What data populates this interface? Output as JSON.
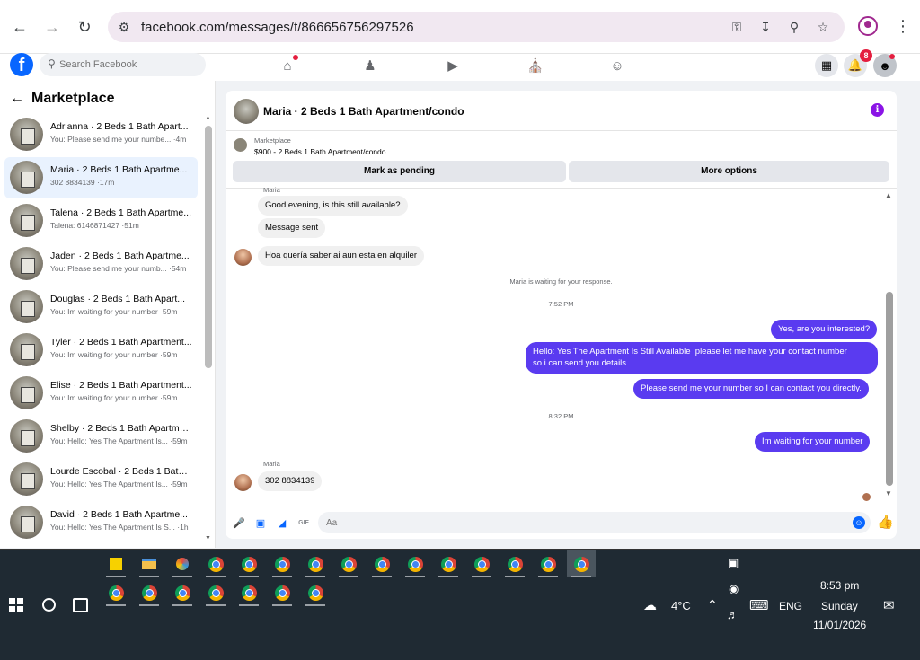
{
  "browser": {
    "url": "facebook.com/messages/t/866656756297526"
  },
  "fb": {
    "logo": "f",
    "search_placeholder": "Search Facebook",
    "notif_count": "8"
  },
  "left_panel": {
    "title": "Marketplace",
    "conversations": [
      {
        "name": "Adrianna · 2 Beds 1 Bath Apart...",
        "preview": "You: Please send me your numbe... ·4m"
      },
      {
        "name": "Maria · 2 Beds 1 Bath Apartme...",
        "preview": "302 8834139 ·17m"
      },
      {
        "name": "Talena · 2 Beds 1 Bath Apartme...",
        "preview": "Talena: 6146871427 ·51m"
      },
      {
        "name": "Jaden · 2 Beds 1 Bath Apartme...",
        "preview": "You: Please send me your numb... ·54m"
      },
      {
        "name": "Douglas · 2 Beds 1 Bath Apart...",
        "preview": "You: Im waiting for your number ·59m"
      },
      {
        "name": "Tyler · 2 Beds 1 Bath Apartment...",
        "preview": "You: Im waiting for your number ·59m"
      },
      {
        "name": "Elise · 2 Beds 1 Bath Apartment...",
        "preview": "You: Im waiting for your number ·59m"
      },
      {
        "name": "Shelby · 2 Beds 1 Bath Apartme...",
        "preview": "You: Hello: Yes The Apartment Is... ·59m"
      },
      {
        "name": "Lourde Escobal · 2 Beds 1 Bath ...",
        "preview": "You: Hello: Yes The Apartment Is... ·59m"
      },
      {
        "name": "David · 2 Beds 1 Bath Apartme...",
        "preview": "You: Hello: Yes The Apartment Is S... ·1h"
      }
    ]
  },
  "chat": {
    "title": "Maria · 2 Beds 1 Bath Apartment/condo",
    "listing_label": "Marketplace",
    "listing_price": "$900 - 2 Beds 1 Bath Apartment/condo",
    "btn_pending": "Mark as pending",
    "btn_more": "More options",
    "sender_top": "Maria",
    "in1": "Good evening, is this still available?",
    "in2": "Message sent",
    "in3": "Hoa quería saber ai aun esta en alquiler",
    "waiting": "Maria is waiting for your response.",
    "time1": "7:52 PM",
    "out1": "Yes, are you interested?",
    "out2_l1": "Hello: Yes The Apartment Is Still Available ,please let me have your contact number",
    "out2_l2": "so i can send you details",
    "out3": "Please send me your number so I can contact you directly.",
    "time2": "8:32 PM",
    "out4": "Im waiting for your number",
    "sender_bottom": "Maria",
    "in4": "302 8834139",
    "composer_placeholder": "Aa"
  },
  "taskbar": {
    "temp": "4°C",
    "lang": "ENG",
    "time": "8:53 pm",
    "day": "Sunday",
    "date": "11/01/2026"
  }
}
